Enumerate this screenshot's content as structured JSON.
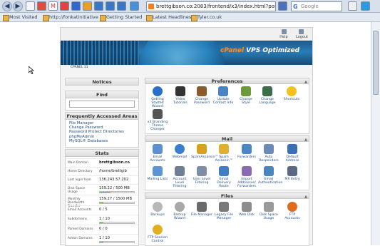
{
  "browser": {
    "url": "brettgibson.co:2083/frontend/x3/index.html?post",
    "search_placeholder": "Google",
    "nav_icons": [
      "back-icon",
      "forward-icon",
      "bookmark-icon",
      "tab-icon",
      "gmail-icon",
      "bookmark-icon",
      "tab-icon",
      "tab-icon",
      "tab-icon",
      "tab-icon",
      "tab-icon",
      "tab-icon"
    ],
    "bookmarks": [
      "Most Visited",
      "http://fonkatinitiative",
      "Getting Started",
      "Latest Headlines",
      "Tyler.co.uk"
    ]
  },
  "cpanel": {
    "top_links": [
      "Help",
      "Logout"
    ],
    "logo_text": "VPS Optimized",
    "logo_brand": "cPanel",
    "breadcrumb": "CPANEL 11",
    "notices_title": "Notices",
    "find_title": "Find",
    "frequent_title": "Frequently Accessed Areas",
    "frequent_links": [
      "File Manager",
      "Change Password",
      "Password Protect Directories",
      "phpMyAdmin",
      "MySQL® Databases"
    ],
    "stats_title": "Stats",
    "stats": [
      {
        "key": "Main Domain",
        "value": "brettgibson.co"
      },
      {
        "key": "Home Directory",
        "value": "/home/brettgib"
      },
      {
        "key": "Last login from",
        "value": "136.243.57.202"
      },
      {
        "key": "Disk Space Usage",
        "value": "159.22 / 500 MB",
        "fill": 0.32
      },
      {
        "key": "Monthly Bandwidth Transfer",
        "value": "159.27 / 1500 MB",
        "fill": 0.11
      },
      {
        "key": "Email Accounts",
        "value": "0 / 5"
      },
      {
        "key": "Subdomains",
        "value": "1 / 10",
        "fill": 0.1
      },
      {
        "key": "Parked Domains",
        "value": "0 / 0"
      },
      {
        "key": "Addon Domains",
        "value": "1 / 10",
        "fill": 0.1
      }
    ],
    "preferences_title": "Preferences",
    "preferences": [
      "Getting Started Wizard",
      "Video Tutorials",
      "Change Password",
      "Update Contact Info",
      "Change Style",
      "Change Language",
      "Shortcuts",
      "x3 Branding Theme Changer"
    ],
    "mail_title": "Mail",
    "mail": [
      "Email Accounts",
      "Webmail",
      "SpamAssassin™",
      "Spam Assassin™",
      "Forwarders",
      "Auto Responders",
      "Default Address",
      "Mailing Lists",
      "Account Level Filtering",
      "User Level Filtering",
      "Email Delivery Route",
      "Import Addresses/ Forwarders",
      "Email Authentication",
      "MX Entry"
    ],
    "files_title": "Files",
    "files": [
      "Backups",
      "Backup Wizard",
      "File Manager",
      "Legacy File Manager",
      "Web Disk",
      "Disk Space Usage",
      "FTP Accounts",
      "FTP Session Control"
    ]
  }
}
